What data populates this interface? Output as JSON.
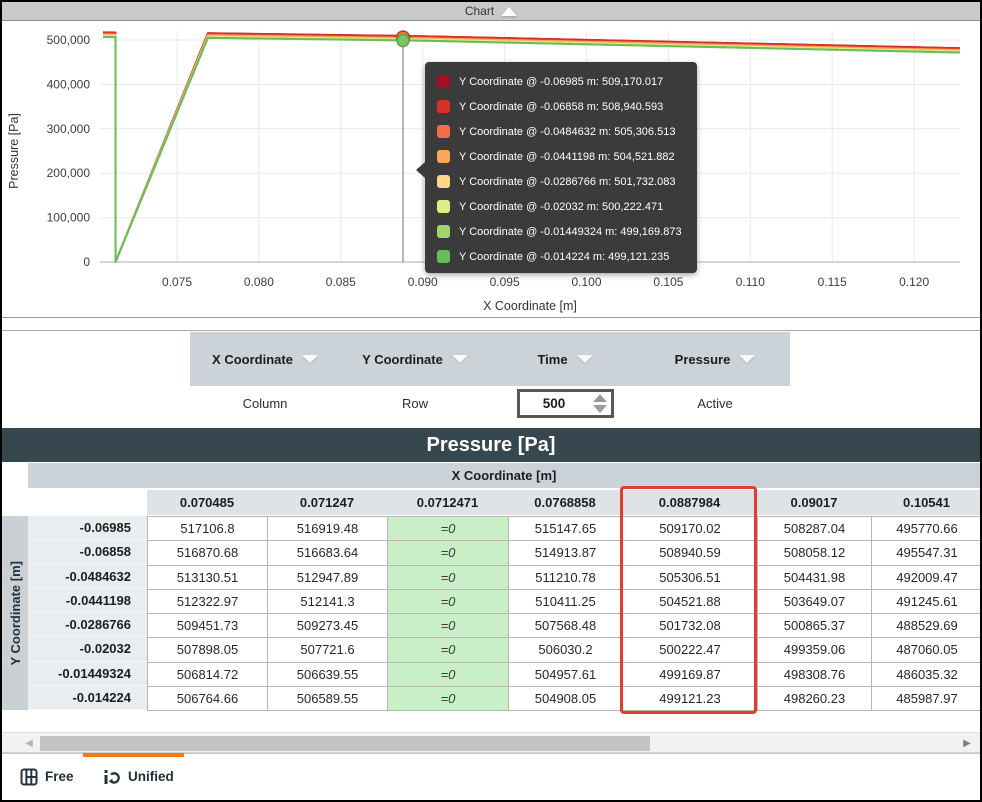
{
  "chart_header": {
    "label": "Chart"
  },
  "chart_data": {
    "type": "line",
    "xlabel": "X Coordinate [m]",
    "ylabel": "Pressure [Pa]",
    "xlim": [
      0.0703,
      0.1228
    ],
    "ylim": [
      0,
      500000
    ],
    "grid": true,
    "legend_position": "tooltip-only",
    "x_ticks": [
      0.075,
      0.08,
      0.085,
      0.09,
      0.095,
      0.1,
      0.105,
      0.11,
      0.115,
      0.12
    ],
    "x_tick_labels": [
      "0.075",
      "0.080",
      "0.085",
      "0.090",
      "0.095",
      "0.100",
      "0.105",
      "0.110",
      "0.115",
      "0.120"
    ],
    "y_ticks": [
      0,
      100000,
      200000,
      300000,
      400000,
      500000
    ],
    "y_tick_labels": [
      "0",
      "100,000",
      "200,000",
      "300,000",
      "400,000",
      "500,000"
    ],
    "x": [
      0.070485,
      0.071247,
      0.0712471,
      0.0768858,
      0.0887984,
      0.09017,
      0.10541,
      0.1228
    ],
    "series": [
      {
        "name": "Y Coordinate @ -0.06985 m",
        "color": "#a50f26",
        "values": [
          517106.8,
          516919.48,
          0,
          515147.65,
          509170.02,
          508287.04,
          495770.66,
          481500
        ]
      },
      {
        "name": "Y Coordinate @ -0.06858 m",
        "color": "#d73027",
        "values": [
          516870.68,
          516683.64,
          0,
          514913.87,
          508940.59,
          508058.12,
          495547.31,
          481280
        ]
      },
      {
        "name": "Y Coordinate @ -0.0484632 m",
        "color": "#f46d43",
        "values": [
          513130.51,
          512947.89,
          0,
          511210.78,
          505306.51,
          504431.98,
          492009.47,
          477750
        ]
      },
      {
        "name": "Y Coordinate @ -0.0441198 m",
        "color": "#f9a75b",
        "values": [
          512322.97,
          512141.3,
          0,
          510411.25,
          504521.88,
          503649.07,
          491245.61,
          476990
        ]
      },
      {
        "name": "Y Coordinate @ -0.0286766 m",
        "color": "#fbd887",
        "values": [
          509451.73,
          509273.45,
          0,
          507568.48,
          501732.08,
          500865.37,
          488529.69,
          474280
        ]
      },
      {
        "name": "Y Coordinate @ -0.02032 m",
        "color": "#d9ef8b",
        "values": [
          507898.05,
          507721.6,
          0,
          506030.2,
          500222.47,
          499359.06,
          487060.05,
          472810
        ]
      },
      {
        "name": "Y Coordinate @ -0.01449324 m",
        "color": "#a2d46a",
        "values": [
          506814.72,
          506639.55,
          0,
          504957.61,
          499169.87,
          498308.76,
          486035.32,
          471790
        ]
      },
      {
        "name": "Y Coordinate @ -0.014224 m",
        "color": "#69bd59",
        "values": [
          506764.66,
          506589.55,
          0,
          504908.05,
          499121.23,
          498260.23,
          485987.97,
          471740
        ]
      }
    ],
    "crosshair_x": 0.0887984,
    "markers": [
      {
        "x": 0.0887984,
        "y": 505306.51,
        "fill": "#f4813f",
        "stroke": "#c23a2b",
        "r": 6.5
      },
      {
        "x": 0.0887984,
        "y": 499121.23,
        "fill": "#76c564",
        "stroke": "#5aa54c",
        "r": 6
      }
    ]
  },
  "tooltip": {
    "items": [
      {
        "color": "#a50f26",
        "label": "Y Coordinate @ -0.06985 m: 509,170.017"
      },
      {
        "color": "#d73027",
        "label": "Y Coordinate @ -0.06858 m: 508,940.593"
      },
      {
        "color": "#f46d43",
        "label": "Y Coordinate @ -0.0484632 m: 505,306.513"
      },
      {
        "color": "#f9a75b",
        "label": "Y Coordinate @ -0.0441198 m: 504,521.882"
      },
      {
        "color": "#fbd887",
        "label": "Y Coordinate @ -0.0286766 m: 501,732.083"
      },
      {
        "color": "#d9ef8b",
        "label": "Y Coordinate @ -0.02032 m: 500,222.471"
      },
      {
        "color": "#a2d46a",
        "label": "Y Coordinate @ -0.01449324 m: 499,169.873"
      },
      {
        "color": "#69bd59",
        "label": "Y Coordinate @ -0.014224 m: 499,121.235"
      }
    ]
  },
  "config": {
    "columns": [
      {
        "label": "X Coordinate",
        "value": "Column"
      },
      {
        "label": "Y Coordinate",
        "value": "Row"
      },
      {
        "label": "Time",
        "value": "500"
      },
      {
        "label": "Pressure",
        "value": "Active"
      }
    ]
  },
  "table": {
    "title": "Pressure [Pa]",
    "col_axis_label": "X Coordinate [m]",
    "row_axis_label": "Y Coordinate [m]",
    "columns": [
      "0.070485",
      "0.071247",
      "0.0712471",
      "0.0768858",
      "0.0887984",
      "0.09017",
      "0.10541"
    ],
    "highlighted_column": "0.0887984",
    "rows": [
      {
        "label": "-0.06985",
        "values": [
          "517106.8",
          "516919.48",
          "=0",
          "515147.65",
          "509170.02",
          "508287.04",
          "495770.66"
        ]
      },
      {
        "label": "-0.06858",
        "values": [
          "516870.68",
          "516683.64",
          "=0",
          "514913.87",
          "508940.59",
          "508058.12",
          "495547.31"
        ]
      },
      {
        "label": "-0.0484632",
        "values": [
          "513130.51",
          "512947.89",
          "=0",
          "511210.78",
          "505306.51",
          "504431.98",
          "492009.47"
        ]
      },
      {
        "label": "-0.0441198",
        "values": [
          "512322.97",
          "512141.3",
          "=0",
          "510411.25",
          "504521.88",
          "503649.07",
          "491245.61"
        ]
      },
      {
        "label": "-0.0286766",
        "values": [
          "509451.73",
          "509273.45",
          "=0",
          "507568.48",
          "501732.08",
          "500865.37",
          "488529.69"
        ]
      },
      {
        "label": "-0.02032",
        "values": [
          "507898.05",
          "507721.6",
          "=0",
          "506030.2",
          "500222.47",
          "499359.06",
          "487060.05"
        ]
      },
      {
        "label": "-0.01449324",
        "values": [
          "506814.72",
          "506639.55",
          "=0",
          "504957.61",
          "499169.87",
          "498308.76",
          "486035.32"
        ]
      },
      {
        "label": "-0.014224",
        "values": [
          "506764.66",
          "506589.55",
          "=0",
          "504908.05",
          "499121.23",
          "498260.23",
          "485987.97"
        ]
      }
    ]
  },
  "scrollbar": {
    "left_arrow": "◀",
    "right_arrow": "▶"
  },
  "footer": {
    "tabs": [
      {
        "label": "Free",
        "icon": "table-grid-icon",
        "active": false
      },
      {
        "label": "Unified",
        "icon": "sync-one-icon",
        "active": true
      }
    ]
  },
  "colors": {
    "accent_orange": "#ee7b18",
    "highlight_red": "#e23b32",
    "table_title_bg": "#37474f",
    "zero_cell_green": "#c8efc6",
    "config_bar_bg": "#ccd3d8",
    "tooltip_bg": "#3b3b3b"
  }
}
